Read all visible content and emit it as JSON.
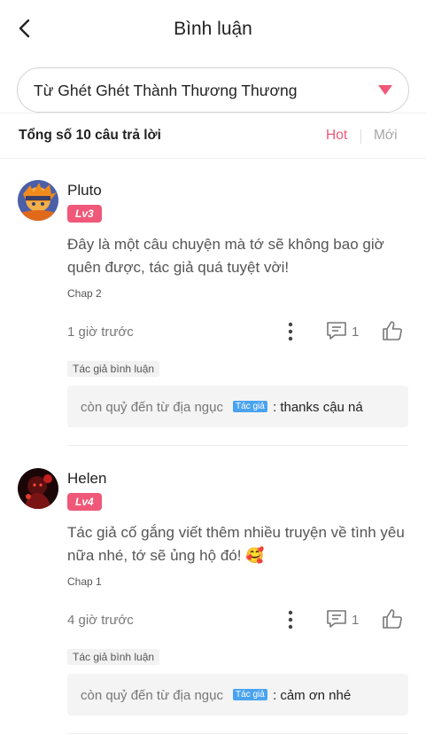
{
  "header": {
    "title": "Bình luận",
    "back_icon": "chevron-left-icon"
  },
  "selector": {
    "value": "Từ Ghét Ghét Thành Thương Thương",
    "icon": "caret-down-icon",
    "accent": "#ef5878"
  },
  "summary": {
    "total_label": "Tổng số 10 câu trả lời",
    "sort_hot": "Hot",
    "sort_new": "Mới"
  },
  "comments": [
    {
      "username": "Pluto",
      "level": "Lv3",
      "text": "Đây là một câu chuyện mà tớ sẽ không bao giờ quên được, tác giả quá tuyệt vời!",
      "chapter": "Chap 2",
      "time": "1 giờ trước",
      "reply_count": "1",
      "author_tag": "Tác giả bình luận",
      "reply": {
        "author": "còn quỷ đến từ địa ngục",
        "badge": "Tác giả",
        "text": ": thanks cậu ná"
      }
    },
    {
      "username": "Helen",
      "level": "Lv4",
      "text": "Tác giả cố gắng viết thêm nhiều truyện về tình yêu nữa nhé, tớ sẽ ủng hộ đó! 🥰",
      "chapter": "Chap 1",
      "time": "4 giờ trước",
      "reply_count": "1",
      "author_tag": "Tác giả bình luận",
      "reply": {
        "author": "còn quỷ đến từ địa ngục",
        "badge": "Tác giả",
        "text": ": cảm ơn nhé"
      }
    }
  ]
}
